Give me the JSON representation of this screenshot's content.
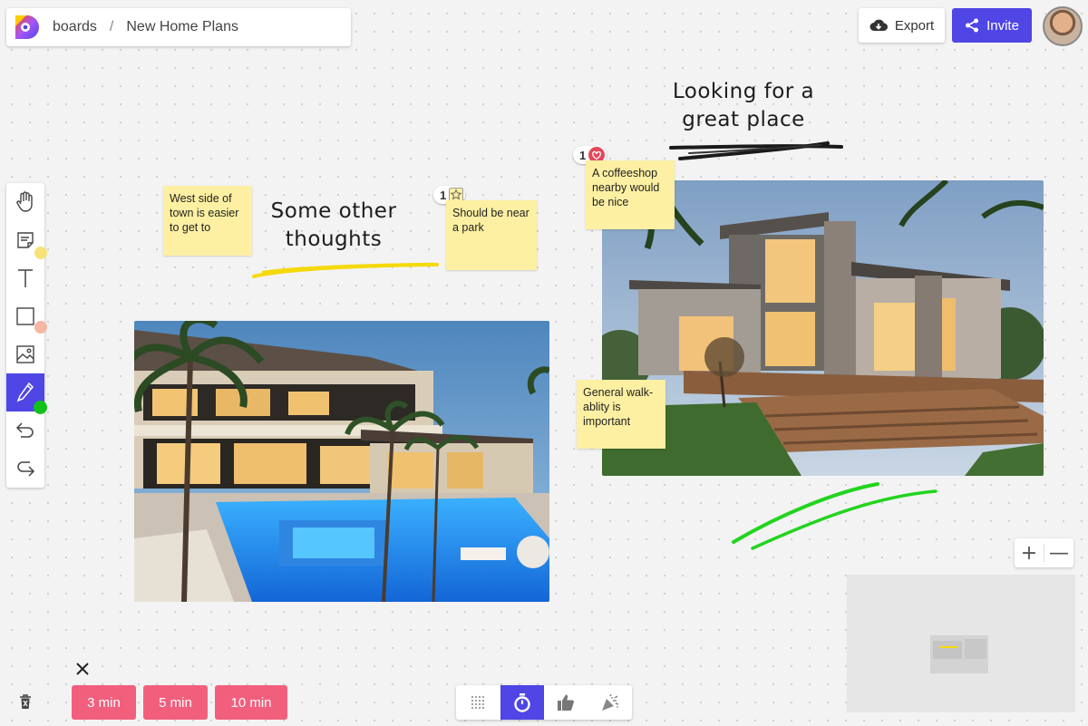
{
  "breadcrumb": {
    "root": "boards",
    "separator": "/",
    "board": "New Home Plans"
  },
  "header": {
    "export_label": "Export",
    "invite_label": "Invite"
  },
  "colors": {
    "accent": "#4f46e5",
    "timer": "#f25f7d",
    "sticky": "#fdf0a2",
    "yellow_stroke": "#f5d90a",
    "green_stroke": "#22d41e"
  },
  "toolbar": {
    "tools": [
      {
        "icon": "hand-icon",
        "active": false
      },
      {
        "icon": "sticky-note-icon",
        "active": false
      },
      {
        "icon": "text-icon",
        "active": false
      },
      {
        "icon": "rectangle-icon",
        "active": false
      },
      {
        "icon": "image-icon",
        "active": false
      },
      {
        "icon": "pen-icon",
        "active": true
      },
      {
        "icon": "undo-icon",
        "active": false
      },
      {
        "icon": "redo-icon",
        "active": false
      }
    ]
  },
  "canvas": {
    "stickies": [
      {
        "text": "West side of town is easier to get to"
      },
      {
        "text": "Should be near a park",
        "badge_count": "1",
        "badge_icon": "star-icon"
      },
      {
        "text": "A coffeeshop nearby would be nice",
        "badge_count": "1",
        "badge_icon": "heart-icon"
      },
      {
        "text": "General walk-ablity is important"
      }
    ],
    "handwritten": [
      {
        "text": "Some other thoughts"
      },
      {
        "text": "Looking for a great place"
      }
    ]
  },
  "timer": {
    "options": [
      "3 min",
      "5 min",
      "10 min"
    ]
  },
  "bottom_bar": {
    "items": [
      "grid-dots-icon",
      "stopwatch-icon",
      "thumbs-up-icon",
      "party-popper-icon"
    ],
    "active_index": 1
  },
  "zoom": {
    "in_label": "+",
    "out_label": "—"
  }
}
